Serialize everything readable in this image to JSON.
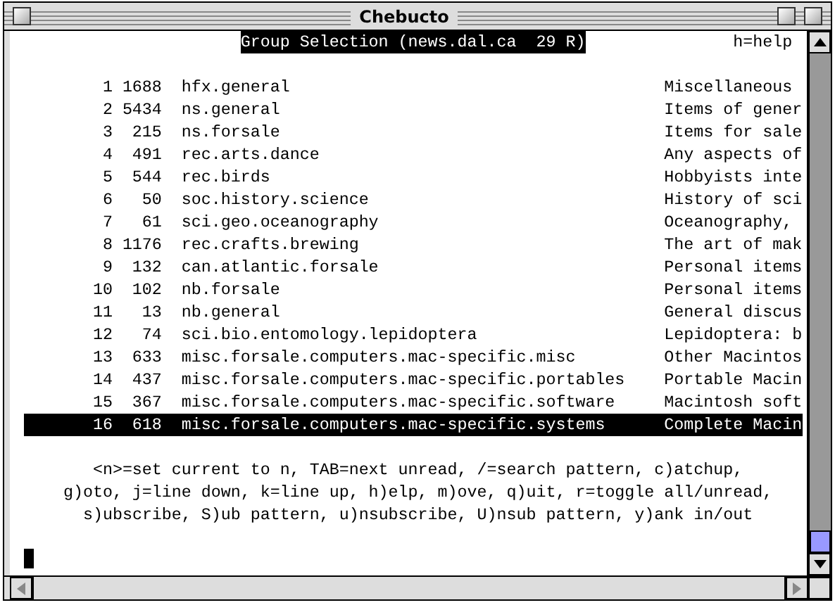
{
  "window": {
    "title": "Chebucto"
  },
  "header": {
    "title": "Group Selection (news.dal.ca  29 R)",
    "help": "h=help"
  },
  "groups": [
    {
      "number": "1",
      "count": "1688",
      "name": "hfx.general",
      "description": "Miscellaneous",
      "selected": false
    },
    {
      "number": "2",
      "count": "5434",
      "name": "ns.general",
      "description": "Items of gener",
      "selected": false
    },
    {
      "number": "3",
      "count": "215",
      "name": "ns.forsale",
      "description": "Items for sale",
      "selected": false
    },
    {
      "number": "4",
      "count": "491",
      "name": "rec.arts.dance",
      "description": "Any aspects of",
      "selected": false
    },
    {
      "number": "5",
      "count": "544",
      "name": "rec.birds",
      "description": "Hobbyists inte",
      "selected": false
    },
    {
      "number": "6",
      "count": "50",
      "name": "soc.history.science",
      "description": "History of sci",
      "selected": false
    },
    {
      "number": "7",
      "count": "61",
      "name": "sci.geo.oceanography",
      "description": "Oceanography,",
      "selected": false
    },
    {
      "number": "8",
      "count": "1176",
      "name": "rec.crafts.brewing",
      "description": "The art of mak",
      "selected": false
    },
    {
      "number": "9",
      "count": "132",
      "name": "can.atlantic.forsale",
      "description": "Personal items",
      "selected": false
    },
    {
      "number": "10",
      "count": "102",
      "name": "nb.forsale",
      "description": "Personal items",
      "selected": false
    },
    {
      "number": "11",
      "count": "13",
      "name": "nb.general",
      "description": "General discus",
      "selected": false
    },
    {
      "number": "12",
      "count": "74",
      "name": "sci.bio.entomology.lepidoptera",
      "description": "Lepidoptera: b",
      "selected": false
    },
    {
      "number": "13",
      "count": "633",
      "name": "misc.forsale.computers.mac-specific.misc",
      "description": "Other Macintos",
      "selected": false
    },
    {
      "number": "14",
      "count": "437",
      "name": "misc.forsale.computers.mac-specific.portables",
      "description": "Portable Macin",
      "selected": false
    },
    {
      "number": "15",
      "count": "367",
      "name": "misc.forsale.computers.mac-specific.software",
      "description": "Macintosh soft",
      "selected": false
    },
    {
      "number": "16",
      "count": "618",
      "name": "misc.forsale.computers.mac-specific.systems",
      "description": "Complete Macin",
      "selected": true
    }
  ],
  "help_lines": [
    "<n>=set current to n, TAB=next unread, /=search pattern, c)atchup,",
    "g)oto, j=line down, k=line up, h)elp, m)ove, q)uit, r=toggle all/unread,",
    "s)ubscribe, S)ub pattern, u)nsubscribe, U)nsub pattern, y)ank in/out"
  ]
}
